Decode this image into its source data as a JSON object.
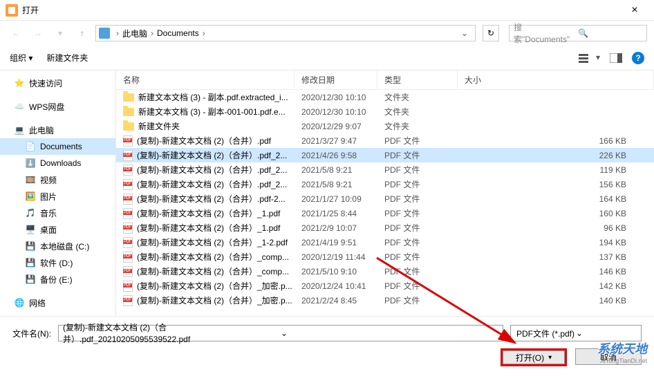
{
  "window": {
    "title": "打开"
  },
  "breadcrumb": {
    "root": "此电脑",
    "folder": "Documents"
  },
  "search": {
    "placeholder": "搜索\"Documents\""
  },
  "toolbar": {
    "organize": "组织",
    "new_folder": "新建文件夹"
  },
  "sidebar": {
    "quick": "快速访问",
    "wps": "WPS网盘",
    "thispc": "此电脑",
    "documents": "Documents",
    "downloads": "Downloads",
    "videos": "视频",
    "pictures": "图片",
    "music": "音乐",
    "desktop": "桌面",
    "diskc": "本地磁盘 (C:)",
    "diskd": "软件 (D:)",
    "diske": "备份 (E:)",
    "network": "网络"
  },
  "columns": {
    "name": "名称",
    "date": "修改日期",
    "type": "类型",
    "size": "大小"
  },
  "type_labels": {
    "folder": "文件夹",
    "pdf": "PDF 文件"
  },
  "files": [
    {
      "icon": "folder",
      "name": "新建文本文档 (3) - 副本.pdf.extracted_i...",
      "date": "2020/12/30 10:10",
      "type": "folder",
      "size": ""
    },
    {
      "icon": "folder",
      "name": "新建文本文档 (3) - 副本-001-001.pdf.e...",
      "date": "2020/12/30 10:10",
      "type": "folder",
      "size": ""
    },
    {
      "icon": "folder",
      "name": "新建文件夹",
      "date": "2020/12/29 9:07",
      "type": "folder",
      "size": ""
    },
    {
      "icon": "pdf",
      "name": "(复制)-新建文本文档 (2)（合并）.pdf",
      "date": "2021/3/27 9:47",
      "type": "pdf",
      "size": "166 KB"
    },
    {
      "icon": "pdf",
      "name": "(复制)-新建文本文档 (2)（合并）.pdf_2...",
      "date": "2021/4/26 9:58",
      "type": "pdf",
      "size": "226 KB",
      "selected": true
    },
    {
      "icon": "pdf",
      "name": "(复制)-新建文本文档 (2)（合并）.pdf_2...",
      "date": "2021/5/8 9:21",
      "type": "pdf",
      "size": "119 KB"
    },
    {
      "icon": "pdf",
      "name": "(复制)-新建文本文档 (2)（合并）.pdf_2...",
      "date": "2021/5/8 9:21",
      "type": "pdf",
      "size": "156 KB"
    },
    {
      "icon": "pdf",
      "name": "(复制)-新建文本文档 (2)（合并）.pdf-2...",
      "date": "2021/1/27 10:09",
      "type": "pdf",
      "size": "164 KB"
    },
    {
      "icon": "pdf",
      "name": "(复制)-新建文本文档 (2)（合并）_1.pdf",
      "date": "2021/1/25 8:44",
      "type": "pdf",
      "size": "160 KB"
    },
    {
      "icon": "pdf",
      "name": "(复制)-新建文本文档 (2)（合并）_1.pdf",
      "date": "2021/2/9 10:07",
      "type": "pdf",
      "size": "96 KB"
    },
    {
      "icon": "pdf",
      "name": "(复制)-新建文本文档 (2)（合并）_1-2.pdf",
      "date": "2021/4/19 9:51",
      "type": "pdf",
      "size": "194 KB"
    },
    {
      "icon": "pdf",
      "name": "(复制)-新建文本文档 (2)（合并）_comp...",
      "date": "2020/12/19 11:44",
      "type": "pdf",
      "size": "137 KB"
    },
    {
      "icon": "pdf",
      "name": "(复制)-新建文本文档 (2)（合并）_comp...",
      "date": "2021/5/10 9:10",
      "type": "pdf",
      "size": "146 KB"
    },
    {
      "icon": "pdf",
      "name": "(复制)-新建文本文档 (2)（合并）_加密.p...",
      "date": "2020/12/24 10:41",
      "type": "pdf",
      "size": "142 KB"
    },
    {
      "icon": "pdf",
      "name": "(复制)-新建文本文档 (2)（合并）_加密.p...",
      "date": "2021/2/24 8:45",
      "type": "pdf",
      "size": "140 KB"
    }
  ],
  "footer": {
    "filename_label": "文件名(N):",
    "filename_value": "(复制)-新建文本文档 (2)（合并）.pdf_20210205095539522.pdf",
    "filter": "PDF文件 (*.pdf)",
    "open": "打开(O)",
    "cancel": "取消"
  },
  "watermark": {
    "line1": "系统天地",
    "line2": "XiTongTianDi.net"
  }
}
